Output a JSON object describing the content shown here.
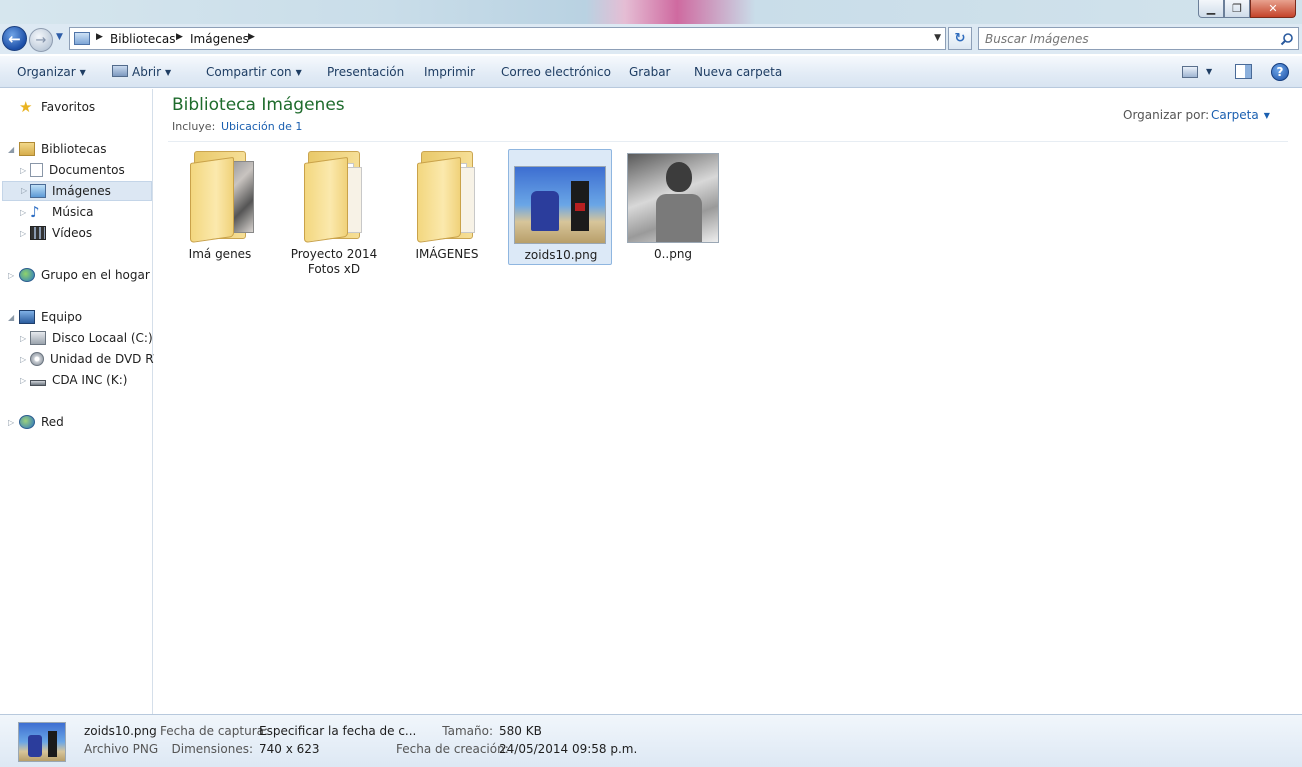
{
  "window": {
    "minimize_icon": "minimize-icon",
    "maximize_icon": "restore-icon",
    "close_icon": "close-icon"
  },
  "address": {
    "crumbs": [
      "Bibliotecas",
      "Imágenes"
    ],
    "search_placeholder": "Buscar Imágenes"
  },
  "toolbar": {
    "organize": "Organizar",
    "open": "Abrir",
    "share": "Compartir con",
    "slideshow": "Presentación",
    "print": "Imprimir",
    "email": "Correo electrónico",
    "burn": "Grabar",
    "new_folder": "Nueva carpeta"
  },
  "sidebar": {
    "favorites": "Favoritos",
    "libraries": "Bibliotecas",
    "library_items": [
      "Documentos",
      "Imágenes",
      "Música",
      "Vídeos"
    ],
    "homegroup": "Grupo en el hogar",
    "computer": "Equipo",
    "computer_items": [
      "Disco Locaal (C:)",
      "Unidad de DVD RW",
      "CDA INC (K:)"
    ],
    "network": "Red"
  },
  "library": {
    "title": "Biblioteca Imágenes",
    "includes_label": "Incluye:",
    "includes_link": "Ubicación de 1",
    "arrange_label": "Organizar por:",
    "arrange_value": "Carpeta"
  },
  "items": [
    {
      "name": "Imá genes",
      "kind": "folder"
    },
    {
      "name": "Proyecto 2014\nFotos xD",
      "kind": "folder"
    },
    {
      "name": "IMÁGENES",
      "kind": "folder"
    },
    {
      "name": "zoids10.png",
      "kind": "image",
      "selected": true
    },
    {
      "name": "0..png",
      "kind": "image"
    }
  ],
  "details": {
    "name": "zoids10.png",
    "type": "Archivo PNG",
    "capture_label": "Fecha de captura:",
    "capture_value": "Especificar la fecha de c...",
    "size_label": "Tamaño:",
    "size_value": "580 KB",
    "dimensions_label": "Dimensiones:",
    "dimensions_value": "740 x 623",
    "created_label": "Fecha de creación:",
    "created_value": "24/05/2014 09:58 p.m."
  }
}
